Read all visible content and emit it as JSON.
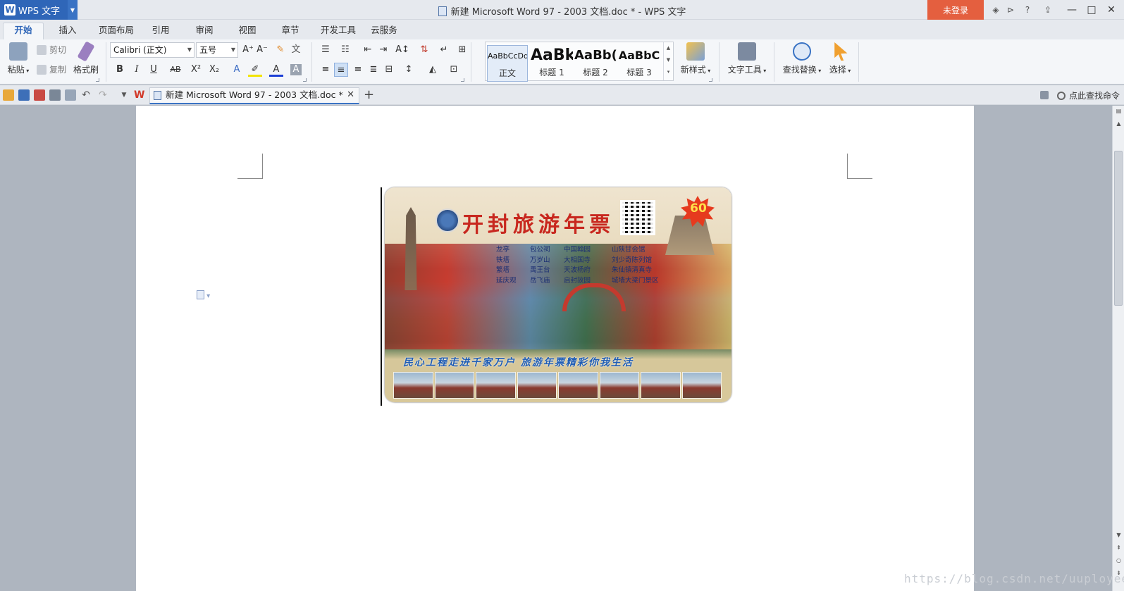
{
  "app": {
    "name": "WPS 文字",
    "window_title": "新建 Microsoft Word 97 - 2003 文档.doc * - WPS 文字",
    "login_label": "未登录"
  },
  "menu": {
    "tabs": [
      "开始",
      "插入",
      "页面布局",
      "引用",
      "审阅",
      "视图",
      "章节",
      "开发工具",
      "云服务"
    ],
    "active": "开始"
  },
  "ribbon": {
    "paste": "粘贴",
    "cut": "剪切",
    "copy": "复制",
    "format_painter": "格式刷",
    "font": "Calibri (正文)",
    "size": "五号",
    "styles": [
      {
        "sample": "AaBbCcDd",
        "name": "正文"
      },
      {
        "sample": "AaBk",
        "name": "标题 1"
      },
      {
        "sample": "AaBb(",
        "name": "标题 2"
      },
      {
        "sample": "AaBbC",
        "name": "标题 3"
      }
    ],
    "new_style": "新样式",
    "text_tools": "文字工具",
    "find_replace": "查找替换",
    "select": "选择"
  },
  "quickbar": {
    "doc_tab": "新建 Microsoft Word 97 - 2003 文档.doc *",
    "search_cmd": "点此查找命令"
  },
  "ticket": {
    "title": "开封旅游年票",
    "badge": "60",
    "places": [
      [
        "龙亭",
        "铁塔",
        "繁塔",
        "延庆观"
      ],
      [
        "包公祠",
        "万岁山",
        "禹王台",
        "岳飞庙"
      ],
      [
        "中国翰园",
        "大相国寺",
        "天波杨府",
        "启封故园"
      ],
      [
        "山陕甘会馆",
        "刘少奇陈列馆",
        "朱仙镇清真寺",
        "城墙大梁门景区"
      ]
    ],
    "slogan": "民心工程走进千家万户    旅游年票精彩你我生活"
  },
  "watermark": "https://blog.csdn.net/uuployee"
}
